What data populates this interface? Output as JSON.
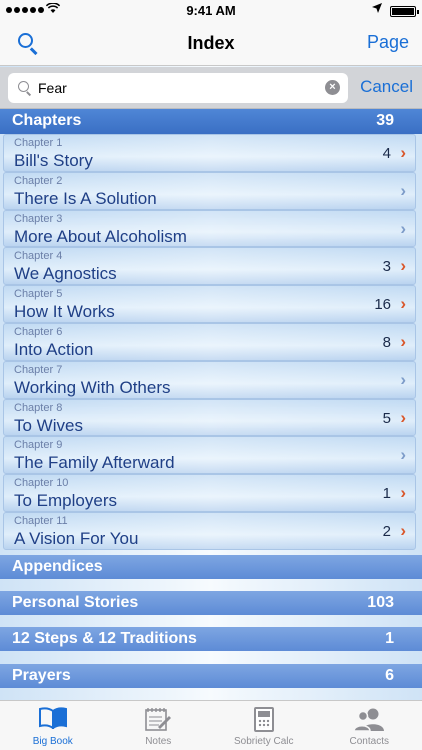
{
  "status": {
    "time": "9:41 AM"
  },
  "nav": {
    "title": "Index",
    "right_label": "Page"
  },
  "search": {
    "value": "Fear",
    "cancel_label": "Cancel"
  },
  "chapters_header": {
    "label": "Chapters",
    "count": "39"
  },
  "chapters": [
    {
      "num": "Chapter 1",
      "name": "Bill's Story",
      "hits": "4",
      "active": true
    },
    {
      "num": "Chapter 2",
      "name": "There Is A Solution",
      "hits": "",
      "active": false
    },
    {
      "num": "Chapter 3",
      "name": "More About Alcoholism",
      "hits": "",
      "active": false
    },
    {
      "num": "Chapter 4",
      "name": "We Agnostics",
      "hits": "3",
      "active": true
    },
    {
      "num": "Chapter 5",
      "name": "How It Works",
      "hits": "16",
      "active": true
    },
    {
      "num": "Chapter 6",
      "name": "Into Action",
      "hits": "8",
      "active": true
    },
    {
      "num": "Chapter 7",
      "name": "Working With Others",
      "hits": "",
      "active": false
    },
    {
      "num": "Chapter 8",
      "name": "To Wives",
      "hits": "5",
      "active": true
    },
    {
      "num": "Chapter 9",
      "name": "The Family Afterward",
      "hits": "",
      "active": false
    },
    {
      "num": "Chapter 10",
      "name": "To Employers",
      "hits": "1",
      "active": true
    },
    {
      "num": "Chapter 11",
      "name": "A Vision For You",
      "hits": "2",
      "active": true
    }
  ],
  "sections": [
    {
      "label": "Appendices",
      "count": ""
    },
    {
      "label": "Personal Stories",
      "count": "103"
    },
    {
      "label": "12 Steps & 12 Traditions",
      "count": "1"
    },
    {
      "label": "Prayers",
      "count": "6"
    }
  ],
  "tabs": [
    {
      "label": "Big Book",
      "icon": "book-icon",
      "selected": true
    },
    {
      "label": "Notes",
      "icon": "notes-icon",
      "selected": false
    },
    {
      "label": "Sobriety Calc",
      "icon": "calculator-icon",
      "selected": false
    },
    {
      "label": "Contacts",
      "icon": "contacts-icon",
      "selected": false
    }
  ],
  "colors": {
    "accent": "#1a6fd6",
    "header": "#3a6fc4",
    "hit_chevron": "#d9572b"
  }
}
